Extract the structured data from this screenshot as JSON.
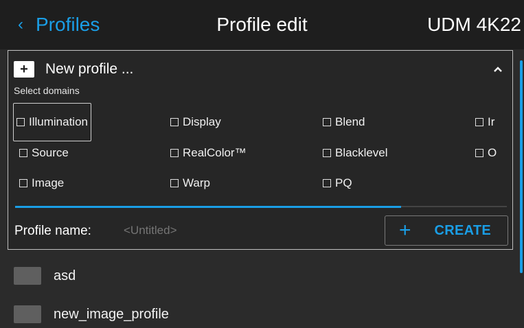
{
  "header": {
    "back_label": "Profiles",
    "title": "Profile edit",
    "device": "UDM 4K22"
  },
  "panel": {
    "new_profile_label": "New profile ...",
    "plus_symbol": "+",
    "select_domains_label": "Select domains",
    "domains": [
      {
        "label": "Illumination",
        "checked": false,
        "focused": true
      },
      {
        "label": "Display",
        "checked": false
      },
      {
        "label": "Blend",
        "checked": false
      },
      {
        "label": "Ir",
        "checked": false
      },
      {
        "label": "Source",
        "checked": false
      },
      {
        "label": "RealColor™",
        "checked": false
      },
      {
        "label": "Blacklevel",
        "checked": false
      },
      {
        "label": "O",
        "checked": false
      },
      {
        "label": "Image",
        "checked": false
      },
      {
        "label": "Warp",
        "checked": false
      },
      {
        "label": "PQ",
        "checked": false
      }
    ],
    "profile_name_label": "Profile name:",
    "profile_name_placeholder": "<Untitled>",
    "profile_name_value": "",
    "create_plus": "+",
    "create_label": "CREATE"
  },
  "profiles": [
    {
      "name": "asd"
    },
    {
      "name": "new_image_profile"
    }
  ],
  "colors": {
    "accent": "#1a9ee6",
    "header_bg": "#1e1e1e",
    "body_bg": "#2b2b2b"
  },
  "icons": {
    "back": "chevron-left-icon",
    "collapse": "chevron-up-icon",
    "checkbox": "checkbox-empty-icon"
  }
}
